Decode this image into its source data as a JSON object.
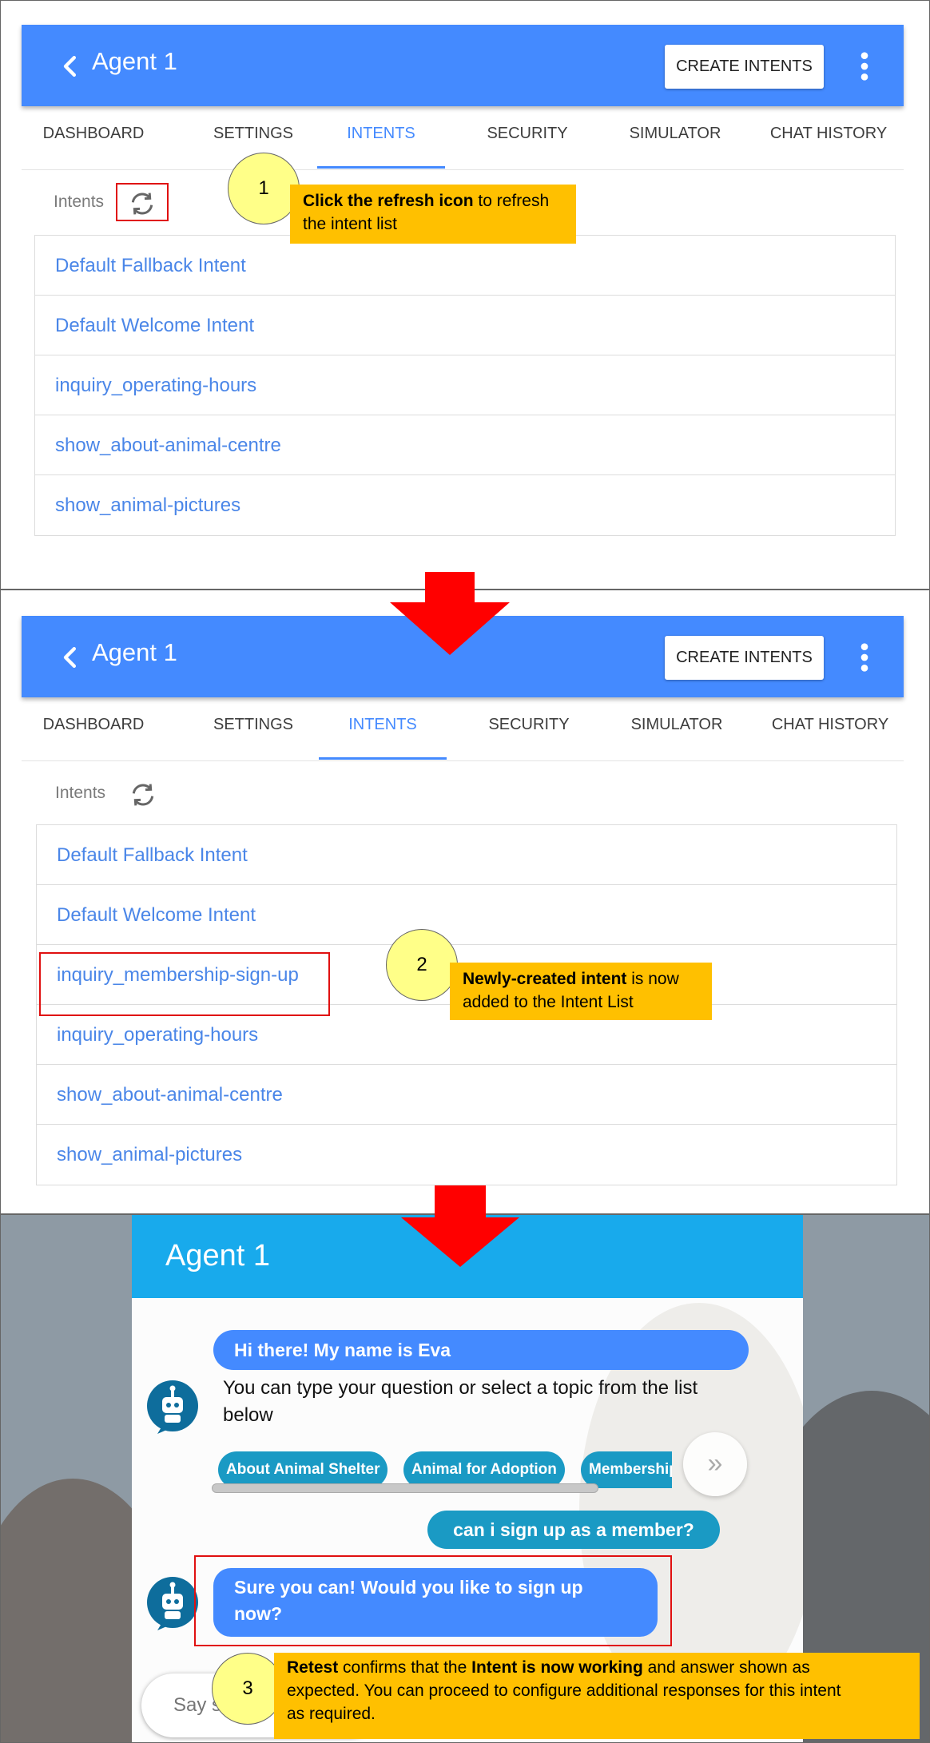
{
  "panel1": {
    "appbar": {
      "title": "Agent 1",
      "create_label": "CREATE INTENTS"
    },
    "tabs": [
      "DASHBOARD",
      "SETTINGS",
      "INTENTS",
      "SECURITY",
      "SIMULATOR",
      "CHAT HISTORY"
    ],
    "active_tab": "INTENTS",
    "intents_label": "Intents",
    "intents": [
      "Default Fallback Intent",
      "Default Welcome Intent",
      "inquiry_operating-hours",
      "show_about-animal-centre",
      "show_animal-pictures"
    ]
  },
  "panel2": {
    "appbar": {
      "title": "Agent 1",
      "create_label": "CREATE INTENTS"
    },
    "tabs": [
      "DASHBOARD",
      "SETTINGS",
      "INTENTS",
      "SECURITY",
      "SIMULATOR",
      "CHAT HISTORY"
    ],
    "active_tab": "INTENTS",
    "intents_label": "Intents",
    "intents": [
      "Default Fallback Intent",
      "Default Welcome Intent",
      "inquiry_membership-sign-up",
      "inquiry_operating-hours",
      "show_about-animal-centre",
      "show_animal-pictures"
    ]
  },
  "callouts": {
    "c1": {
      "number": "1",
      "bold": "Click the refresh icon",
      "rest1": " to refresh",
      "rest2": "the intent list"
    },
    "c2": {
      "number": "2",
      "bold": "Newly-created intent",
      "rest1": " is now",
      "rest2": "added to the Intent List"
    },
    "c3": {
      "number": "3",
      "bold1": "Retest",
      "t1": " confirms that the ",
      "bold2": "Intent is now working",
      "t2": " and answer shown as",
      "line2": "expected. You can proceed to configure additional responses for this intent",
      "line3": "as required."
    }
  },
  "chat": {
    "title": "Agent 1",
    "greeting": "Hi there! My name is Eva",
    "prompt_line1": "You can type your question or select a topic from the list",
    "prompt_line2": "below",
    "chips": [
      "About Animal Shelter",
      "Animal for Adoption",
      "Membership Sign Up"
    ],
    "scroll_button": "»",
    "user_message": "can i sign up as a member?",
    "bot_reply_line1": "Sure you can! Would you like to sign up",
    "bot_reply_line2": "now?",
    "input_placeholder": "Say s"
  },
  "colors": {
    "appbar": "#448aff",
    "chat_header": "#18aaec",
    "callout": "#ffc000",
    "highlight": "#e01010",
    "arrow": "#ff0000"
  }
}
